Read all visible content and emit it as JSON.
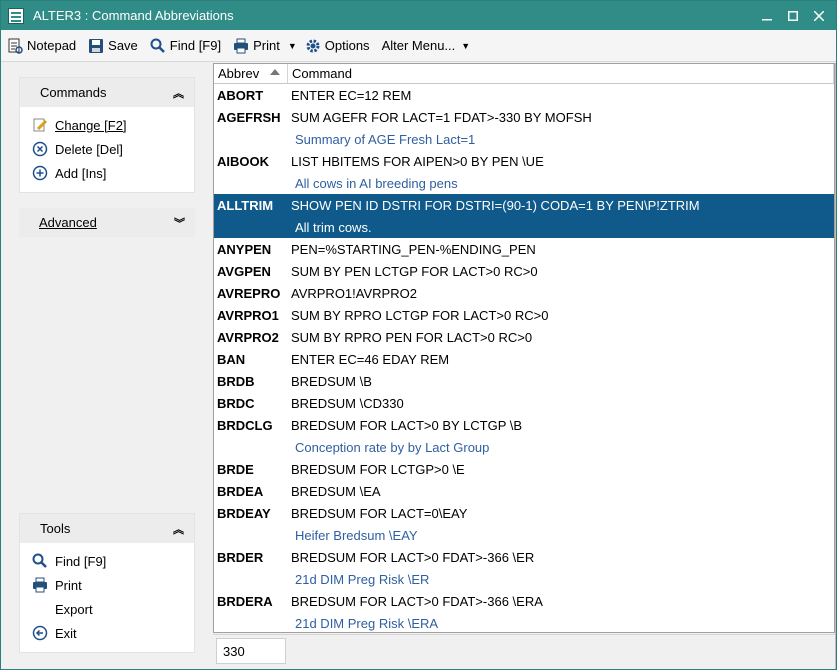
{
  "window": {
    "title": "ALTER3 : Command Abbreviations"
  },
  "toolbar": {
    "notepad": "Notepad",
    "save": "Save",
    "find": "Find [F9]",
    "print": "Print",
    "options": "Options",
    "alter_menu": "Alter Menu..."
  },
  "commands_panel": {
    "title": "Commands",
    "items": [
      {
        "label": "Change [F2]",
        "icon": "edit-icon"
      },
      {
        "label": "Delete [Del]",
        "icon": "delete-icon"
      },
      {
        "label": "Add [Ins]",
        "icon": "add-icon"
      }
    ]
  },
  "advanced_panel": {
    "title": "Advanced"
  },
  "tools_panel": {
    "title": "Tools",
    "items": [
      {
        "label": "Find [F9]",
        "icon": "search-icon"
      },
      {
        "label": "Print",
        "icon": "printer-icon"
      },
      {
        "label": "Export",
        "icon": ""
      },
      {
        "label": "Exit",
        "icon": "exit-icon"
      }
    ]
  },
  "grid": {
    "columns": [
      "Abbrev",
      "Command"
    ],
    "rows": [
      {
        "abbrev": "ABORT",
        "command": "ENTER EC=12 REM",
        "desc": ""
      },
      {
        "abbrev": "AGEFRSH",
        "command": "SUM AGEFR FOR LACT=1 FDAT>-330 BY MOFSH",
        "desc": "Summary of AGE Fresh Lact=1"
      },
      {
        "abbrev": "AIBOOK",
        "command": "LIST HBITEMS FOR AIPEN>0 BY PEN \\UE",
        "desc": "All cows in AI breeding pens"
      },
      {
        "abbrev": "ALLTRIM",
        "command": "SHOW PEN ID DSTRI FOR DSTRI=(90-1) CODA=1 BY PEN\\P!ZTRIM",
        "desc": "All trim cows.",
        "selected": true
      },
      {
        "abbrev": "ANYPEN",
        "command": "PEN=%STARTING_PEN-%ENDING_PEN",
        "desc": ""
      },
      {
        "abbrev": "AVGPEN",
        "command": "SUM BY PEN LCTGP FOR LACT>0 RC>0",
        "desc": ""
      },
      {
        "abbrev": "AVREPRO",
        "command": "AVRPRO1!AVRPRO2",
        "desc": ""
      },
      {
        "abbrev": "AVRPRO1",
        "command": "SUM BY RPRO LCTGP FOR LACT>0 RC>0",
        "desc": ""
      },
      {
        "abbrev": "AVRPRO2",
        "command": "SUM BY RPRO PEN FOR LACT>0 RC>0",
        "desc": ""
      },
      {
        "abbrev": "BAN",
        "command": "ENTER EC=46 EDAY REM",
        "desc": ""
      },
      {
        "abbrev": "BRDB",
        "command": "BREDSUM \\B",
        "desc": ""
      },
      {
        "abbrev": "BRDC",
        "command": "BREDSUM \\CD330",
        "desc": ""
      },
      {
        "abbrev": "BRDCLG",
        "command": "BREDSUM FOR LACT>0 BY LCTGP \\B",
        "desc": "Conception rate by by Lact Group"
      },
      {
        "abbrev": "BRDE",
        "command": "BREDSUM FOR LCTGP>0 \\E",
        "desc": ""
      },
      {
        "abbrev": "BRDEA",
        "command": "BREDSUM \\EA",
        "desc": ""
      },
      {
        "abbrev": "BRDEAY",
        "command": "BREDSUM FOR LACT=0\\EAY",
        "desc": "Heifer Bredsum \\EAY"
      },
      {
        "abbrev": "BRDER",
        "command": "BREDSUM FOR LACT>0 FDAT>-366 \\ER",
        "desc": "21d DIM Preg Risk \\ER"
      },
      {
        "abbrev": "BRDERA",
        "command": "BREDSUM FOR LACT>0 FDAT>-366 \\ERA",
        "desc": "21d DIM Preg Risk \\ERA"
      }
    ]
  },
  "status": {
    "count": "330"
  }
}
